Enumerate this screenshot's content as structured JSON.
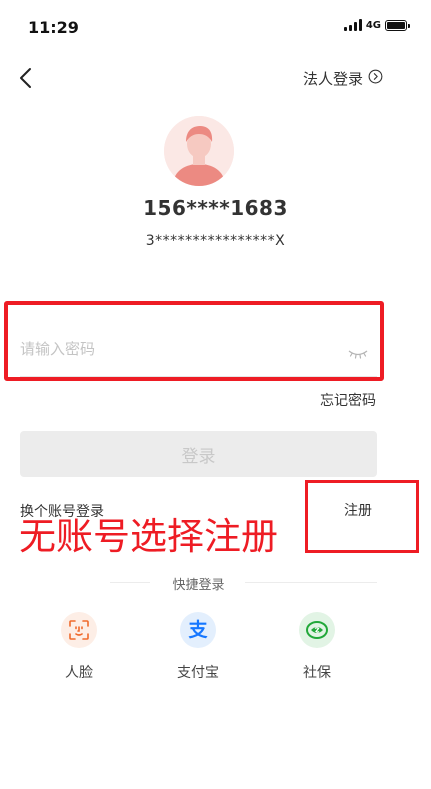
{
  "status": {
    "time": "11:29",
    "network": "4G",
    "battery": 1.0
  },
  "header": {
    "corp_login_label": "法人登录"
  },
  "user": {
    "phone_masked": "156****1683",
    "id_masked": "3****************X"
  },
  "password": {
    "placeholder": "请输入密码"
  },
  "forgot_password_label": "忘记密码",
  "login_button_label": "登录",
  "switch_account_label": "换个账号登录",
  "register_label": "注册",
  "annotation_text": "无账号选择注册",
  "quick_login": {
    "title": "快捷登录",
    "items": [
      {
        "label": "人脸",
        "icon": "face-scan-icon",
        "color": "#f06a2c"
      },
      {
        "label": "支付宝",
        "icon": "alipay-icon",
        "color": "#1677ff"
      },
      {
        "label": "社保",
        "icon": "social-security-icon",
        "color": "#22a83a"
      }
    ]
  },
  "colors": {
    "highlight": "#ee1c24",
    "avatar": "#ec8a82"
  }
}
